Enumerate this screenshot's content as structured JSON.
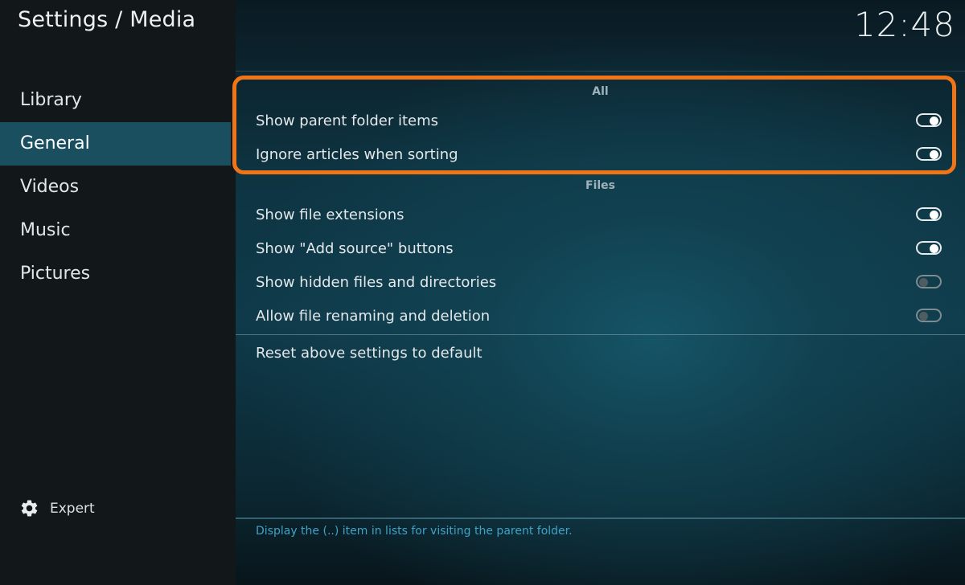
{
  "header": {
    "title": "Settings / Media",
    "clock": "12:48"
  },
  "sidebar": {
    "items": [
      {
        "label": "Library",
        "active": false
      },
      {
        "label": "General",
        "active": true
      },
      {
        "label": "Videos",
        "active": false
      },
      {
        "label": "Music",
        "active": false
      },
      {
        "label": "Pictures",
        "active": false
      }
    ],
    "expert_label": "Expert",
    "expert_icon": "gear-icon"
  },
  "sections": {
    "all": {
      "title": "All",
      "settings": [
        {
          "label": "Show parent folder items",
          "enabled": true
        },
        {
          "label": "Ignore articles when sorting",
          "enabled": true
        }
      ]
    },
    "files": {
      "title": "Files",
      "settings": [
        {
          "label": "Show file extensions",
          "enabled": true
        },
        {
          "label": "Show \"Add source\" buttons",
          "enabled": true
        },
        {
          "label": "Show hidden files and directories",
          "enabled": false
        },
        {
          "label": "Allow file renaming and deletion",
          "enabled": false
        }
      ]
    }
  },
  "reset_label": "Reset above settings to default",
  "help_text": "Display the (..) item in lists for visiting the parent folder.",
  "colors": {
    "highlight": "#f07516",
    "active_nav": "#1a4f60",
    "help_text": "#3fa3c7"
  }
}
